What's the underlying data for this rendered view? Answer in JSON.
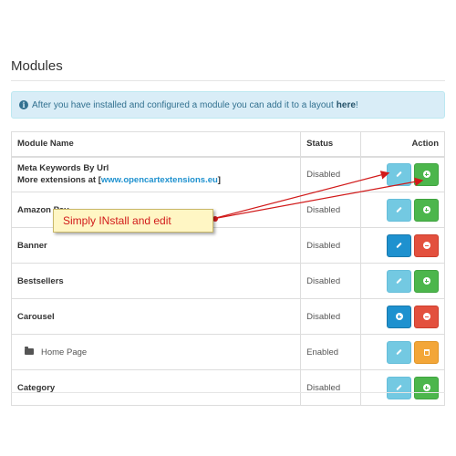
{
  "page": {
    "title": "Modules"
  },
  "alert": {
    "text": "After you have installed and configured a module you can add it to a layout",
    "link": "here",
    "suffix": "!"
  },
  "table": {
    "headers": {
      "name": "Module Name",
      "status": "Status",
      "action": "Action"
    },
    "rows": [
      {
        "name": "Meta Keywords By Url",
        "extra_prefix": "More extensions at [",
        "extra_link": "www.opencartextensions.eu",
        "extra_suffix": "]",
        "status": "Disabled"
      },
      {
        "name": "Amazon Pay",
        "status": "Disabled"
      },
      {
        "name": "Banner",
        "status": "Disabled"
      },
      {
        "name": "Bestsellers",
        "status": "Disabled"
      },
      {
        "name": "Carousel",
        "status": "Disabled"
      },
      {
        "name": "Home Page",
        "status": "Enabled"
      },
      {
        "name": "Category",
        "status": "Disabled"
      }
    ]
  },
  "callout": {
    "text": "Simply INstall and edit"
  },
  "colors": {
    "edit": "#1e91cf",
    "install": "#4cb64c",
    "uninstall": "#e3503e",
    "delete": "#f3a638",
    "alert_bg": "#d9edf7",
    "callout_text": "#d11a1a"
  }
}
